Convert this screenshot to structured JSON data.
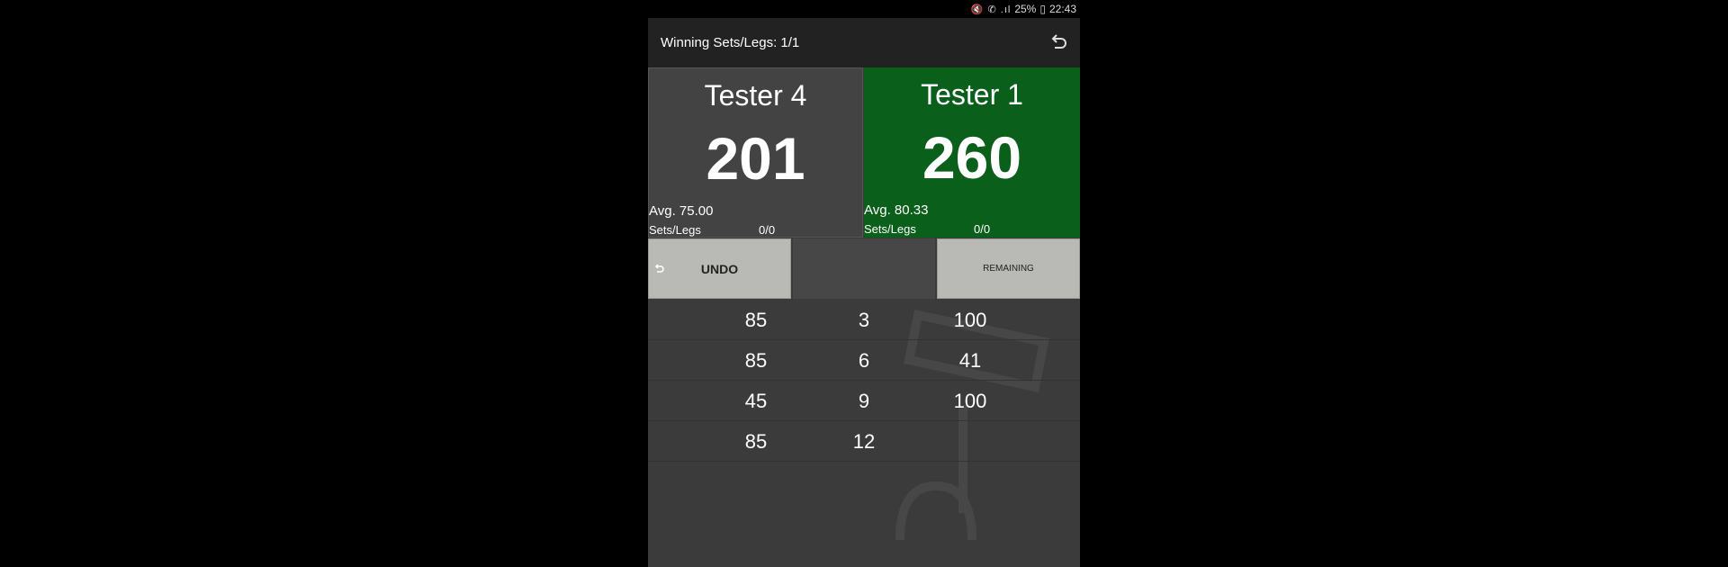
{
  "status_bar": {
    "icons": "🔇 ✆ .ıl",
    "battery": "25%",
    "time": "22:43"
  },
  "toolbar": {
    "title": "Winning Sets/Legs: 1/1",
    "undo_icon": "undo-arrow-icon"
  },
  "players": [
    {
      "name": "Tester 4",
      "score": "201",
      "avg": "Avg. 75.00",
      "sets_legs_label": "Sets/Legs",
      "sets_legs_value": "0/0",
      "active": false
    },
    {
      "name": "Tester 1",
      "score": "260",
      "avg": "Avg. 80.33",
      "sets_legs_label": "Sets/Legs",
      "sets_legs_value": "0/0",
      "active": true
    }
  ],
  "controls": {
    "undo_label": "UNDO",
    "remaining_label": "REMAINING"
  },
  "history": [
    {
      "left": "85",
      "dart": "3",
      "right": "100"
    },
    {
      "left": "85",
      "dart": "6",
      "right": "41"
    },
    {
      "left": "45",
      "dart": "9",
      "right": "100"
    },
    {
      "left": "85",
      "dart": "12",
      "right": ""
    }
  ],
  "colors": {
    "active_player": "#0a5f1b",
    "inactive_player": "#434343",
    "toolbar": "#222222",
    "button": "#b9b9b6"
  }
}
